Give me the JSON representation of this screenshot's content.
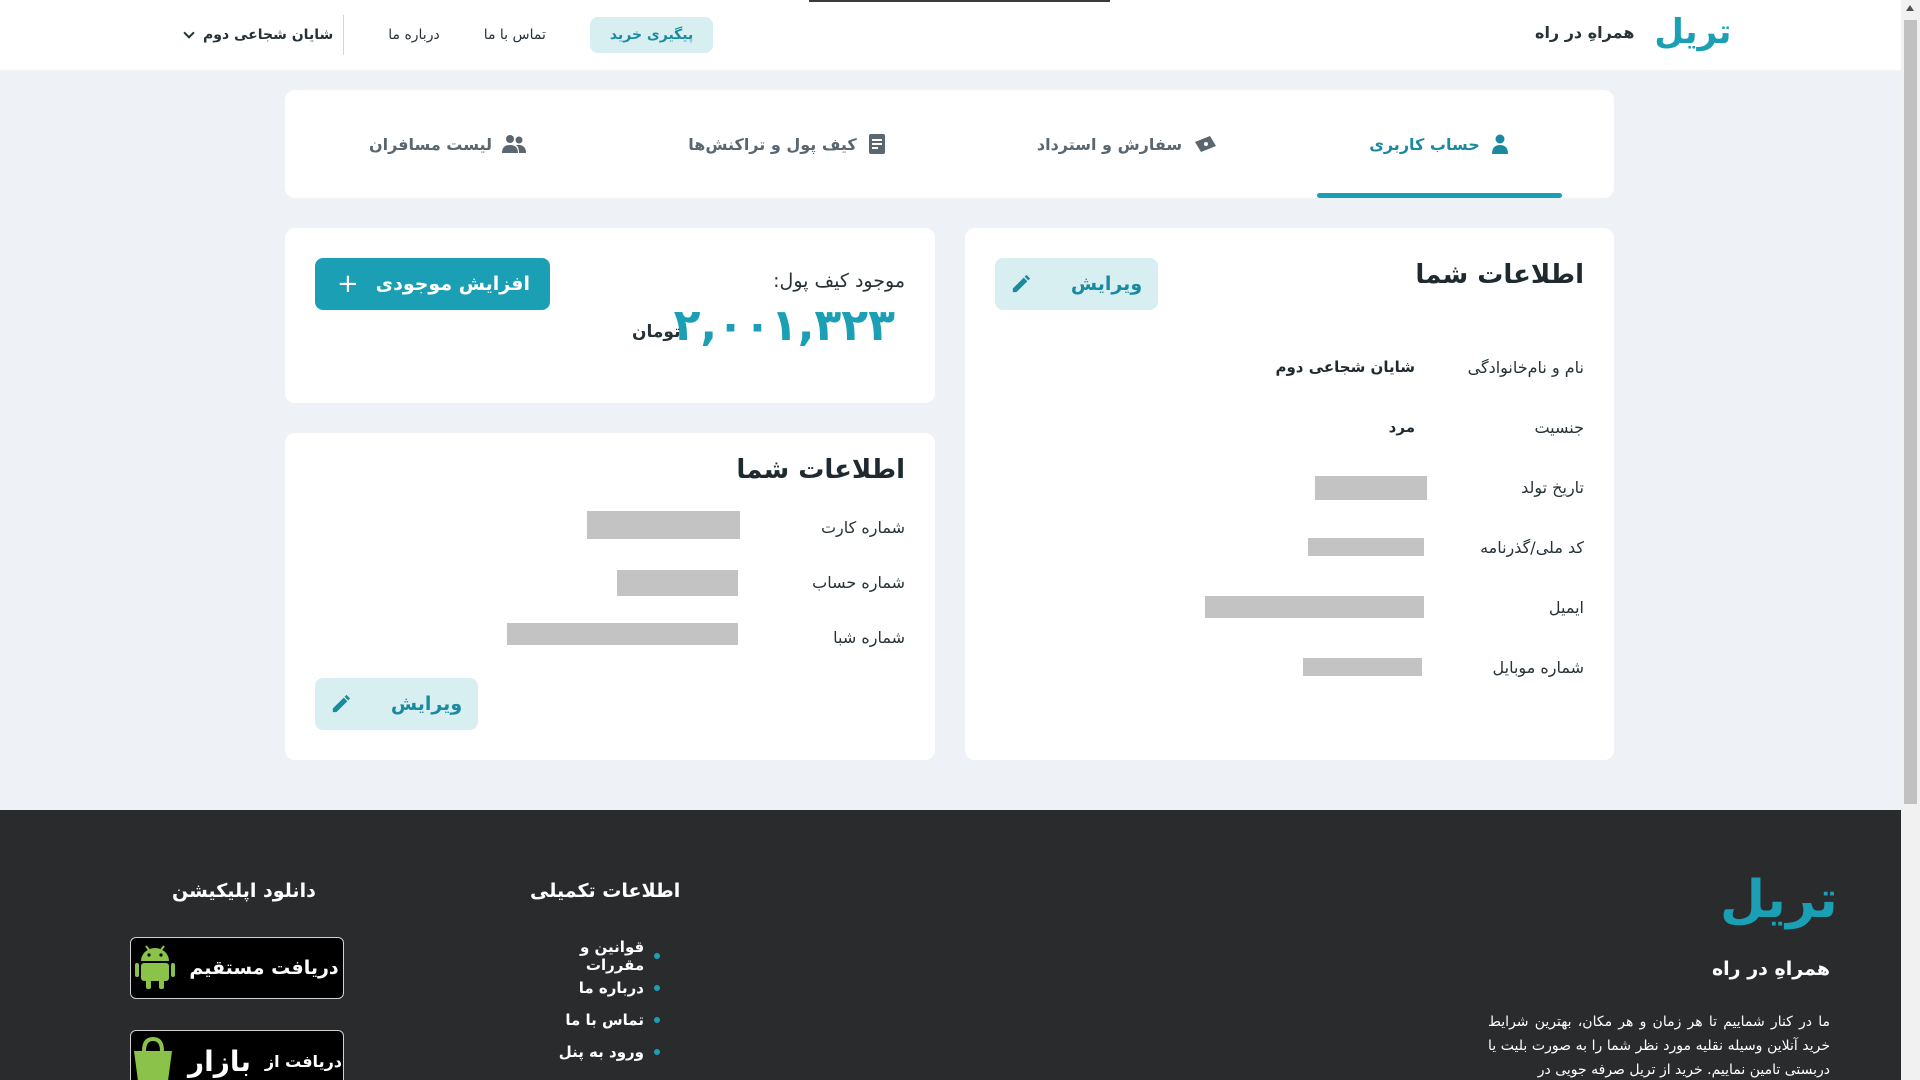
{
  "header": {
    "logo": "تریل",
    "tagline": "همراهِ در راه",
    "nav": {
      "track_purchase": "پیگیری خرید",
      "contact": "تماس با ما",
      "about": "درباره ما",
      "user_name": "شایان شجاعی دوم"
    }
  },
  "tabs": [
    {
      "label": "حساب کاربری",
      "icon": "user-icon",
      "active": true
    },
    {
      "label": "سفارش و استرداد",
      "icon": "ticket-icon",
      "active": false
    },
    {
      "label": "کیف پول و تراکنش‌ها",
      "icon": "receipt-icon",
      "active": false
    },
    {
      "label": "لیست مسافران",
      "icon": "users-icon",
      "active": false
    }
  ],
  "profile": {
    "title": "اطلاعات شما",
    "edit_label": "ویرایش",
    "rows": [
      {
        "label": "نام و نام‌خانوادگی",
        "value": "شایان شجاعی دوم"
      },
      {
        "label": "جنسیت",
        "value": "مرد"
      },
      {
        "label": "تاریخ تولد",
        "value": ""
      },
      {
        "label": "کد ملی/گذرنامه",
        "value": ""
      },
      {
        "label": "ایمیل",
        "value": ""
      },
      {
        "label": "شماره موبایل",
        "value": ""
      }
    ]
  },
  "wallet": {
    "label": "موجود کیف پول:",
    "amount": "۲,۰۰۱,۳۲۳",
    "unit": "تومان",
    "add_label": "افزایش موجودی"
  },
  "bank": {
    "title": "اطلاعات شما",
    "edit_label": "ویرایش",
    "rows": [
      {
        "label": "شماره کارت",
        "value": ""
      },
      {
        "label": "شماره حساب",
        "value": ""
      },
      {
        "label": "شماره شبا",
        "value": ""
      }
    ]
  },
  "footer": {
    "logo": "تریل",
    "tagline": "همراهِ در راه",
    "description": "ما در کنار شماییم تا هر زمان و هر مکان، بهترین شرایط خرید آنلاین وسیله نقلیه مورد نظر شما را به صورت بلیت یا دربستی تامین نماییم. خرید از تریل صرفه جویی در",
    "info_heading": "اطلاعات تکمیلی",
    "links": [
      "قوانین و مقررات",
      "درباره ما",
      "تماس با ما",
      "ورود به پنل"
    ],
    "download_heading": "دانلود اپلیکیشن",
    "direct_download": "دریافت مستقیم",
    "bazaar_prefix": "دریافت از",
    "bazaar_name": "بازار"
  },
  "colors": {
    "accent": "#1a9fb4",
    "accent_light": "#d8eff2",
    "footer_bg": "#2a2b2d",
    "page_bg": "#eef1f6"
  }
}
